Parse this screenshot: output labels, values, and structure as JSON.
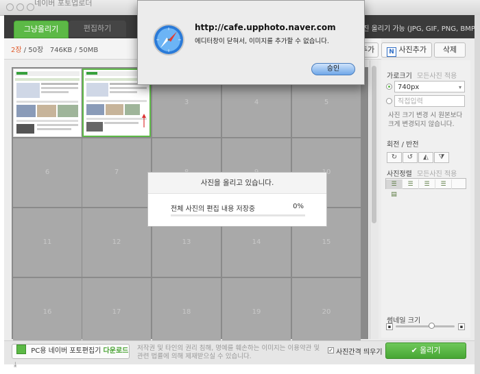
{
  "window": {
    "title_partial": "네이버 포토업로더"
  },
  "tabs": [
    {
      "label": "그냥올리기"
    },
    {
      "label": "편집하기"
    }
  ],
  "top_info": "사진 올리기 가능 (JPG, GIF, PNG, BMP)",
  "toolbar": {
    "count_current": "2장",
    "count_max": "/ 50장",
    "size_current": "746KB",
    "size_max": "/ 50MB"
  },
  "right_buttons": {
    "add_photo": "사진추가",
    "delete": "삭제",
    "cut_partial": "추가"
  },
  "grid_numbers": [
    "3",
    "4",
    "5",
    "6",
    "7",
    "8",
    "9",
    "10",
    "11",
    "12",
    "13",
    "14",
    "15",
    "16",
    "17",
    "18",
    "19",
    "20"
  ],
  "sidebar": {
    "width_label": "가로크기",
    "width_all": "모든사진 적용",
    "width_value": "740px",
    "direct_input_placeholder": "직접입력",
    "note": "사진 크기 변경 시 원본보다 크게 변경되지 않습니다.",
    "rotate_label": "회전 / 반전",
    "align_label": "사진정렬",
    "align_all": "모든사진 적용",
    "thumb_size_label": "썸네일 크기"
  },
  "bottom": {
    "pc_editor": "PC용 네이버 포토편집기",
    "download": "다운로드",
    "legal": "저작권 및 타인의 권리 침해, 명예를 훼손하는 이미지는 이용약관 및 관련 법률에 의해 제재받으실 수 있습니다.",
    "spacing_label": "사진간격 띄우기",
    "upload": "올리기"
  },
  "dialog": {
    "title": "http://cafe.upphoto.naver.com",
    "message": "에디터창이 닫혀서, 이미지를 추가할 수 없습니다.",
    "ok": "승인"
  },
  "progress": {
    "title": "사진을 올리고 있습니다.",
    "label": "전체 사진의 편집 내용 저장중",
    "percent": "0%",
    "value": 0
  },
  "colors": {
    "accent": "#5cb946",
    "count_highlight": "#e05a2b",
    "ok_button": "#6fa7e8"
  }
}
